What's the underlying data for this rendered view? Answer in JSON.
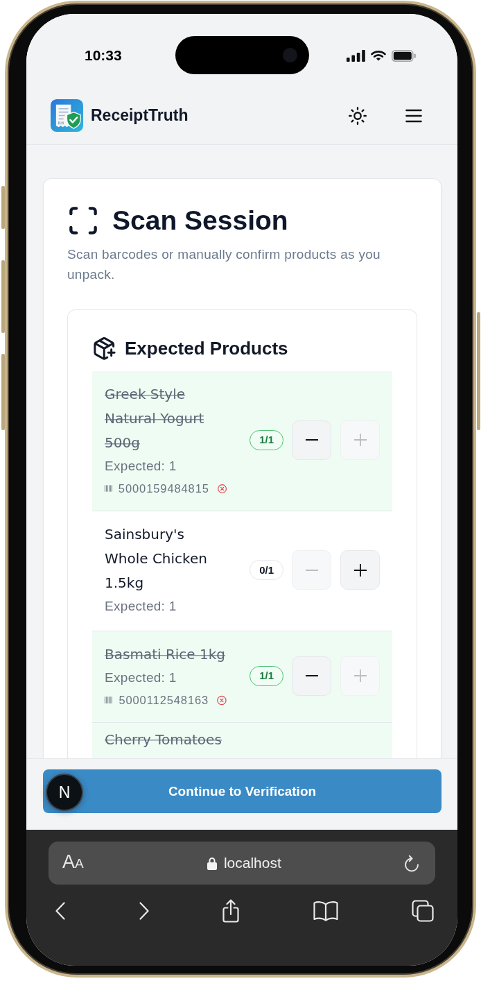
{
  "status_bar": {
    "time": "10:33"
  },
  "header": {
    "app_name": "ReceiptTruth"
  },
  "scan_session": {
    "title": "Scan Session",
    "description": "Scan barcodes or manually confirm products as you unpack.",
    "expected_products": {
      "title": "Expected Products",
      "items": [
        {
          "name": "Greek Style Natural Yogurt 500g",
          "expected": "Expected: 1",
          "barcode": "5000159484815",
          "count": "1/1",
          "complete": true,
          "decrease_disabled": false,
          "increase_disabled": true
        },
        {
          "name": "Sainsbury's Whole Chicken 1.5kg",
          "expected": "Expected: 1",
          "count": "0/1",
          "complete": false,
          "decrease_disabled": true,
          "increase_disabled": false
        },
        {
          "name": "Basmati Rice 1kg",
          "expected": "Expected: 1",
          "barcode": "5000112548163",
          "count": "1/1",
          "complete": true,
          "decrease_disabled": false,
          "increase_disabled": true
        },
        {
          "name": "Cherry Tomatoes",
          "complete": true
        }
      ]
    }
  },
  "footer": {
    "continue_button": "Continue to Verification"
  },
  "dev_indicator": {
    "label": "N"
  },
  "browser": {
    "text_size_button": "AA",
    "url": "localhost"
  }
}
